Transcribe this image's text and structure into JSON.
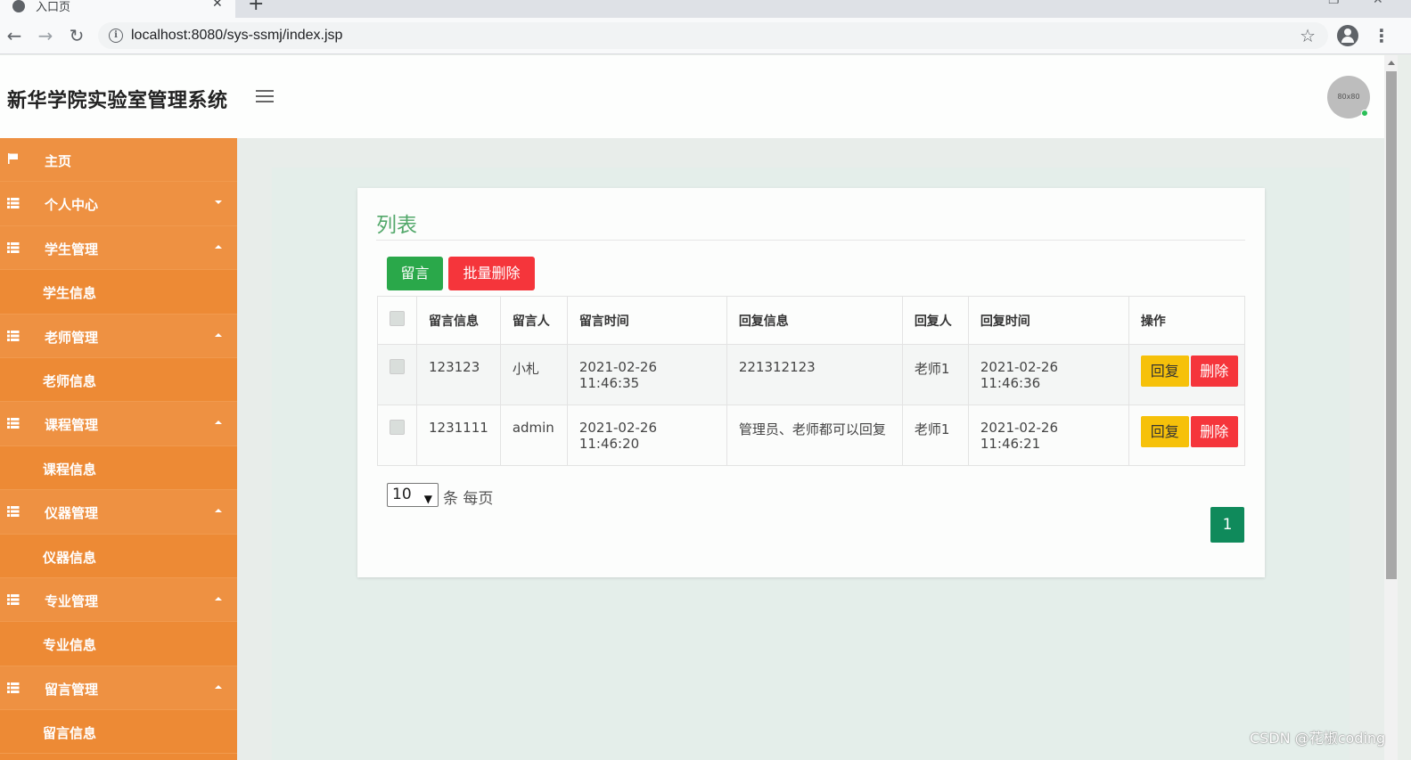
{
  "browser": {
    "tab_title": "入口页",
    "url": "localhost:8080/sys-ssmj/index.jsp"
  },
  "app": {
    "title": "新华学院实验室管理系统",
    "avatar_text": "80x80"
  },
  "sidebar": {
    "items": [
      {
        "label": "主页",
        "type": "home",
        "icon": "flag-icon"
      },
      {
        "label": "个人中心",
        "type": "parent",
        "caret": "down",
        "icon": "grid-icon"
      },
      {
        "label": "学生管理",
        "type": "parent",
        "caret": "up",
        "icon": "grid-icon"
      },
      {
        "label": "学生信息",
        "type": "child"
      },
      {
        "label": "老师管理",
        "type": "parent",
        "caret": "up",
        "icon": "grid-icon"
      },
      {
        "label": "老师信息",
        "type": "child"
      },
      {
        "label": "课程管理",
        "type": "parent",
        "caret": "up",
        "icon": "grid-icon"
      },
      {
        "label": "课程信息",
        "type": "child"
      },
      {
        "label": "仪器管理",
        "type": "parent",
        "caret": "up",
        "icon": "grid-icon"
      },
      {
        "label": "仪器信息",
        "type": "child"
      },
      {
        "label": "专业管理",
        "type": "parent",
        "caret": "up",
        "icon": "grid-icon"
      },
      {
        "label": "专业信息",
        "type": "child"
      },
      {
        "label": "留言管理",
        "type": "parent",
        "caret": "up",
        "icon": "grid-icon"
      },
      {
        "label": "留言信息",
        "type": "child"
      }
    ]
  },
  "main": {
    "card_title": "列表",
    "btn_add": "留言",
    "btn_batch_delete": "批量删除",
    "table": {
      "headers": [
        "留言信息",
        "留言人",
        "留言时间",
        "回复信息",
        "回复人",
        "回复时间",
        "操作"
      ],
      "rows": [
        [
          "123123",
          "小札",
          "2021-02-26 11:46:35",
          "221312123",
          "老师1",
          "2021-02-26 11:46:36"
        ],
        [
          "1231111",
          "admin",
          "2021-02-26 11:46:20",
          "管理员、老师都可以回复",
          "老师1",
          "2021-02-26 11:46:21"
        ]
      ],
      "action_reply": "回复",
      "action_delete": "删除"
    },
    "pager": {
      "page_size": "10",
      "per_page_text": "条 每页",
      "current_page": "1"
    }
  },
  "watermark": "CSDN @花椒coding",
  "colors": {
    "sidebar": "#ed8a35",
    "title_green": "#52a86a",
    "btn_green": "#2aa84a",
    "btn_red": "#f5353b",
    "btn_yellow": "#f6c10a",
    "page_active": "#0f8a5b"
  }
}
